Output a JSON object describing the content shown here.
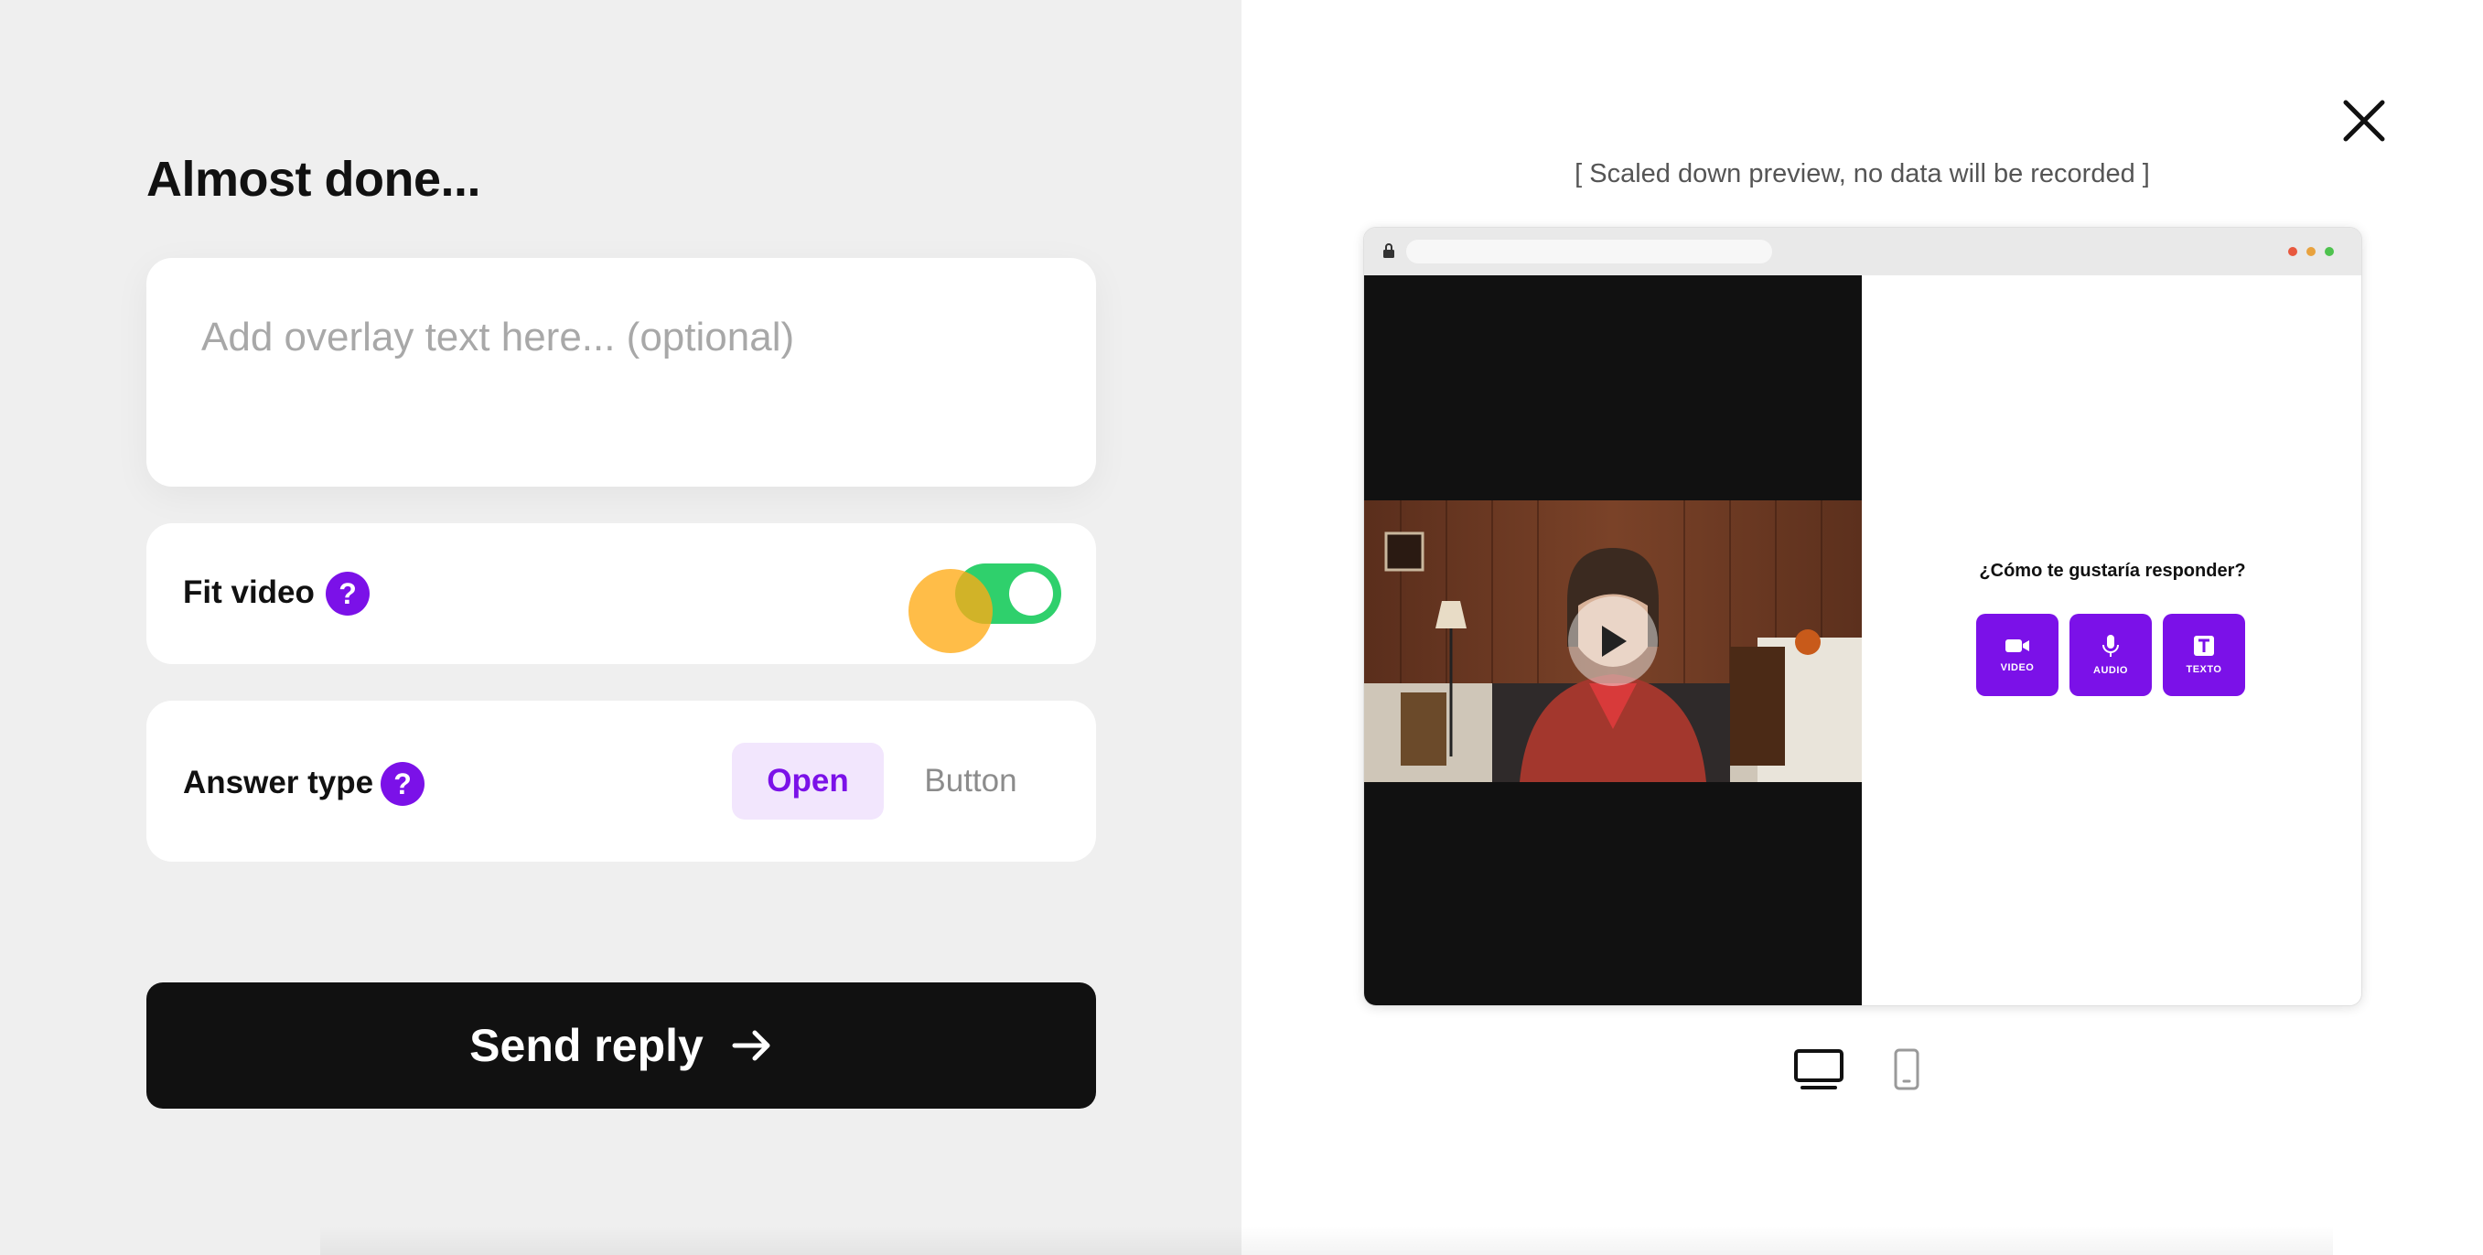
{
  "left": {
    "heading": "Almost done...",
    "overlay_placeholder": "Add overlay text here... (optional)",
    "fit_video": {
      "label": "Fit video",
      "help": "?",
      "enabled": true
    },
    "answer_type": {
      "label": "Answer type",
      "help": "?",
      "options": [
        "Open",
        "Button"
      ],
      "selected": "Open"
    },
    "send_button": {
      "label": "Send reply",
      "arrow": "→"
    }
  },
  "right": {
    "close_icon": "close-icon",
    "preview_note": "[ Scaled down preview, no data will be recorded ]",
    "preview": {
      "question": "¿Cómo te gustaría responder?",
      "reply_options": [
        {
          "label": "VIDEO",
          "icon": "video-camera-icon"
        },
        {
          "label": "AUDIO",
          "icon": "microphone-icon"
        },
        {
          "label": "TEXTO",
          "icon": "text-icon"
        }
      ]
    },
    "device_modes": [
      "desktop",
      "mobile"
    ],
    "selected_device": "desktop"
  },
  "colors": {
    "accent_purple": "#7b11e8",
    "toggle_green": "#2fd06c",
    "button_black": "#111111",
    "left_bg": "#efefef"
  }
}
